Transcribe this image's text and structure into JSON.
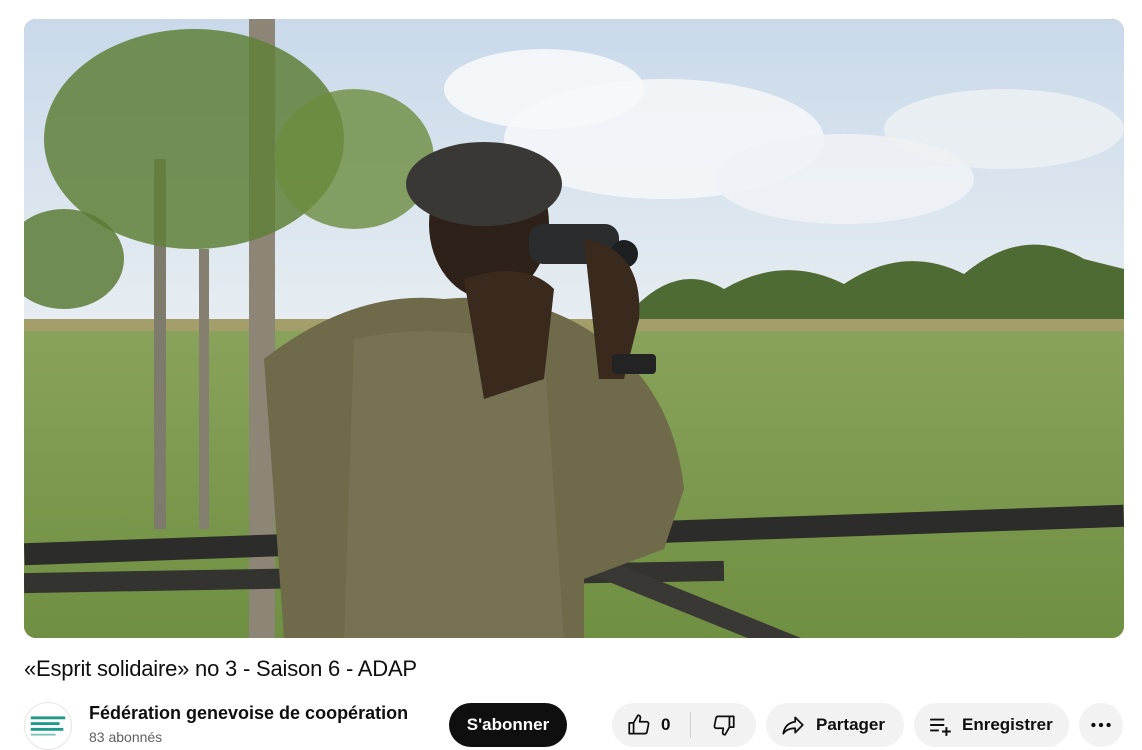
{
  "video": {
    "title": "«Esprit solidaire» no 3 - Saison 6 - ADAP",
    "thumbnail_icon": "video-frame-ranger-binoculars"
  },
  "channel": {
    "name": "Fédération genevoise de coopération",
    "subscribers": "83 abonnés",
    "avatar_icon": "fgc-logo-icon"
  },
  "actions": {
    "subscribe_label": "S'abonner",
    "like_count": "0",
    "share_label": "Partager",
    "save_label": "Enregistrer",
    "like_icon": "thumbs-up-icon",
    "dislike_icon": "thumbs-down-icon",
    "share_icon": "share-arrow-icon",
    "save_icon": "playlist-add-icon",
    "more_icon": "more-horizontal-icon"
  },
  "colors": {
    "subscribe_bg": "#0f0f0f",
    "pill_bg": "#f2f2f2",
    "secondary_text": "#606060"
  }
}
